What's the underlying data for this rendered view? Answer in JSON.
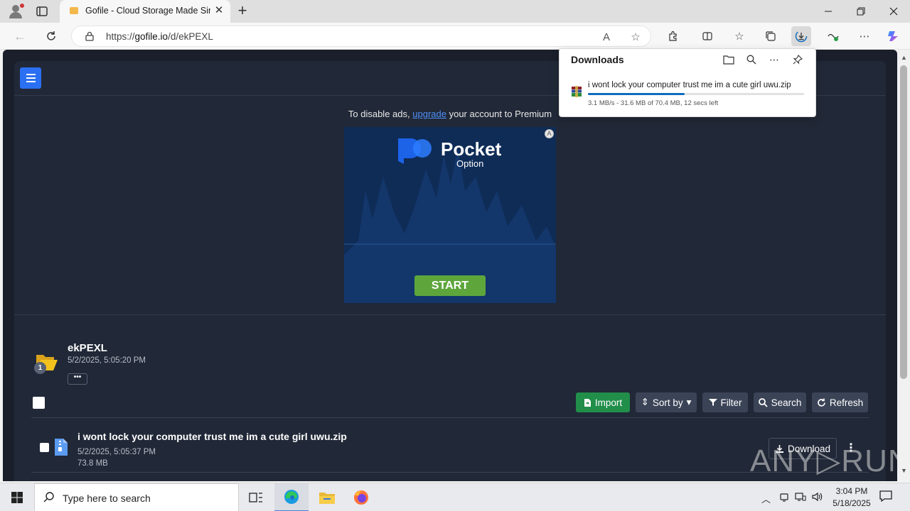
{
  "browser": {
    "tab_title": "Gofile - Cloud Storage Made Sim",
    "url_prefix": "https://",
    "url_host": "gofile.io",
    "url_path": "/d/ekPEXL"
  },
  "downloads_panel": {
    "title": "Downloads",
    "file_name": "i wont lock your computer trust me im a cute girl uwu.zip",
    "status": "3.1 MB/s - 31.6 MB of 70.4 MB, 12 secs left",
    "progress_fraction": 0.449
  },
  "page": {
    "ad_notice_prefix": "To disable ads,",
    "ad_notice_link": "upgrade",
    "ad_notice_suffix": "your account to Premium",
    "ad": {
      "brand": "Pocket",
      "brand_sub": "Option",
      "cta": "START"
    },
    "folder": {
      "name": "ekPEXL",
      "date": "5/2/2025, 5:05:20 PM",
      "count_badge": "1",
      "more_label": "•••"
    },
    "toolbar": {
      "import_label": "Import",
      "sort_label": "Sort by",
      "filter_label": "Filter",
      "search_label": "Search",
      "refresh_label": "Refresh"
    },
    "files": [
      {
        "name": "i wont lock your computer trust me im a cute girl uwu.zip",
        "date": "5/2/2025, 5:05:37 PM",
        "size": "73.8 MB",
        "download_label": "Download"
      }
    ],
    "watermark": "ANY▷RUN"
  },
  "taskbar": {
    "search_placeholder": "Type here to search",
    "time": "3:04 PM",
    "date": "5/18/2025"
  },
  "colors": {
    "page_bg": "#1a1f2b",
    "panel_bg": "#212837",
    "accent_blue": "#2b6ff2",
    "import_green": "#218e4a",
    "ad_start_green": "#5ea63c",
    "progress_blue": "#0f6cbd"
  }
}
